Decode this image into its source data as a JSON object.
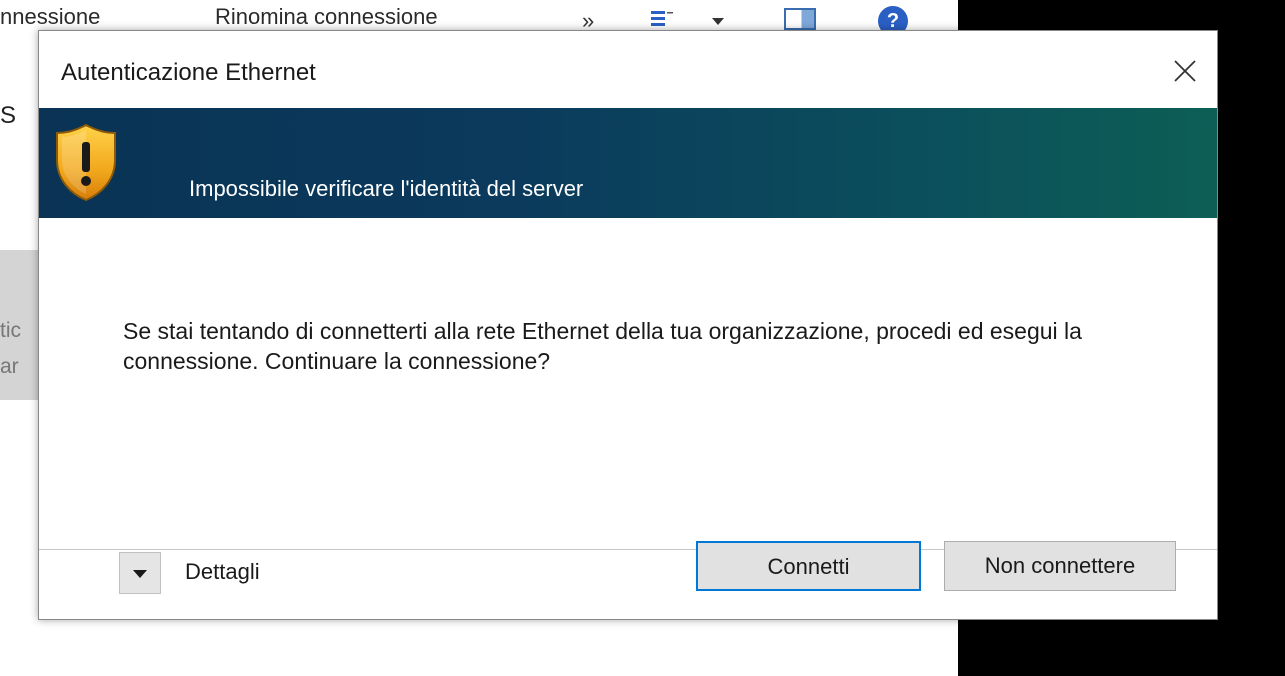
{
  "background_window": {
    "toolbar_item_1": "nnessione",
    "toolbar_item_2": "Rinomina connessione",
    "overflow_chevron": "»",
    "help_glyph": "?",
    "side_letter": "S",
    "side_fragment_1": "tic",
    "side_fragment_2": "ar"
  },
  "dialog": {
    "title": "Autenticazione Ethernet",
    "close_glyph": "✕",
    "banner": {
      "icon": "shield-warning-icon",
      "heading": "Impossibile verificare l'identità del server",
      "gradient_colors": [
        "#0a3355",
        "#0d5f55"
      ]
    },
    "message": "Se stai tentando di connetterti alla rete Ethernet della tua organizzazione, procedi ed esegui la connessione. Continuare la connessione?",
    "details_label": "Dettagli",
    "buttons": {
      "connect": "Connetti",
      "dont_connect": "Non connettere"
    },
    "accent_color": "#0078d7"
  }
}
